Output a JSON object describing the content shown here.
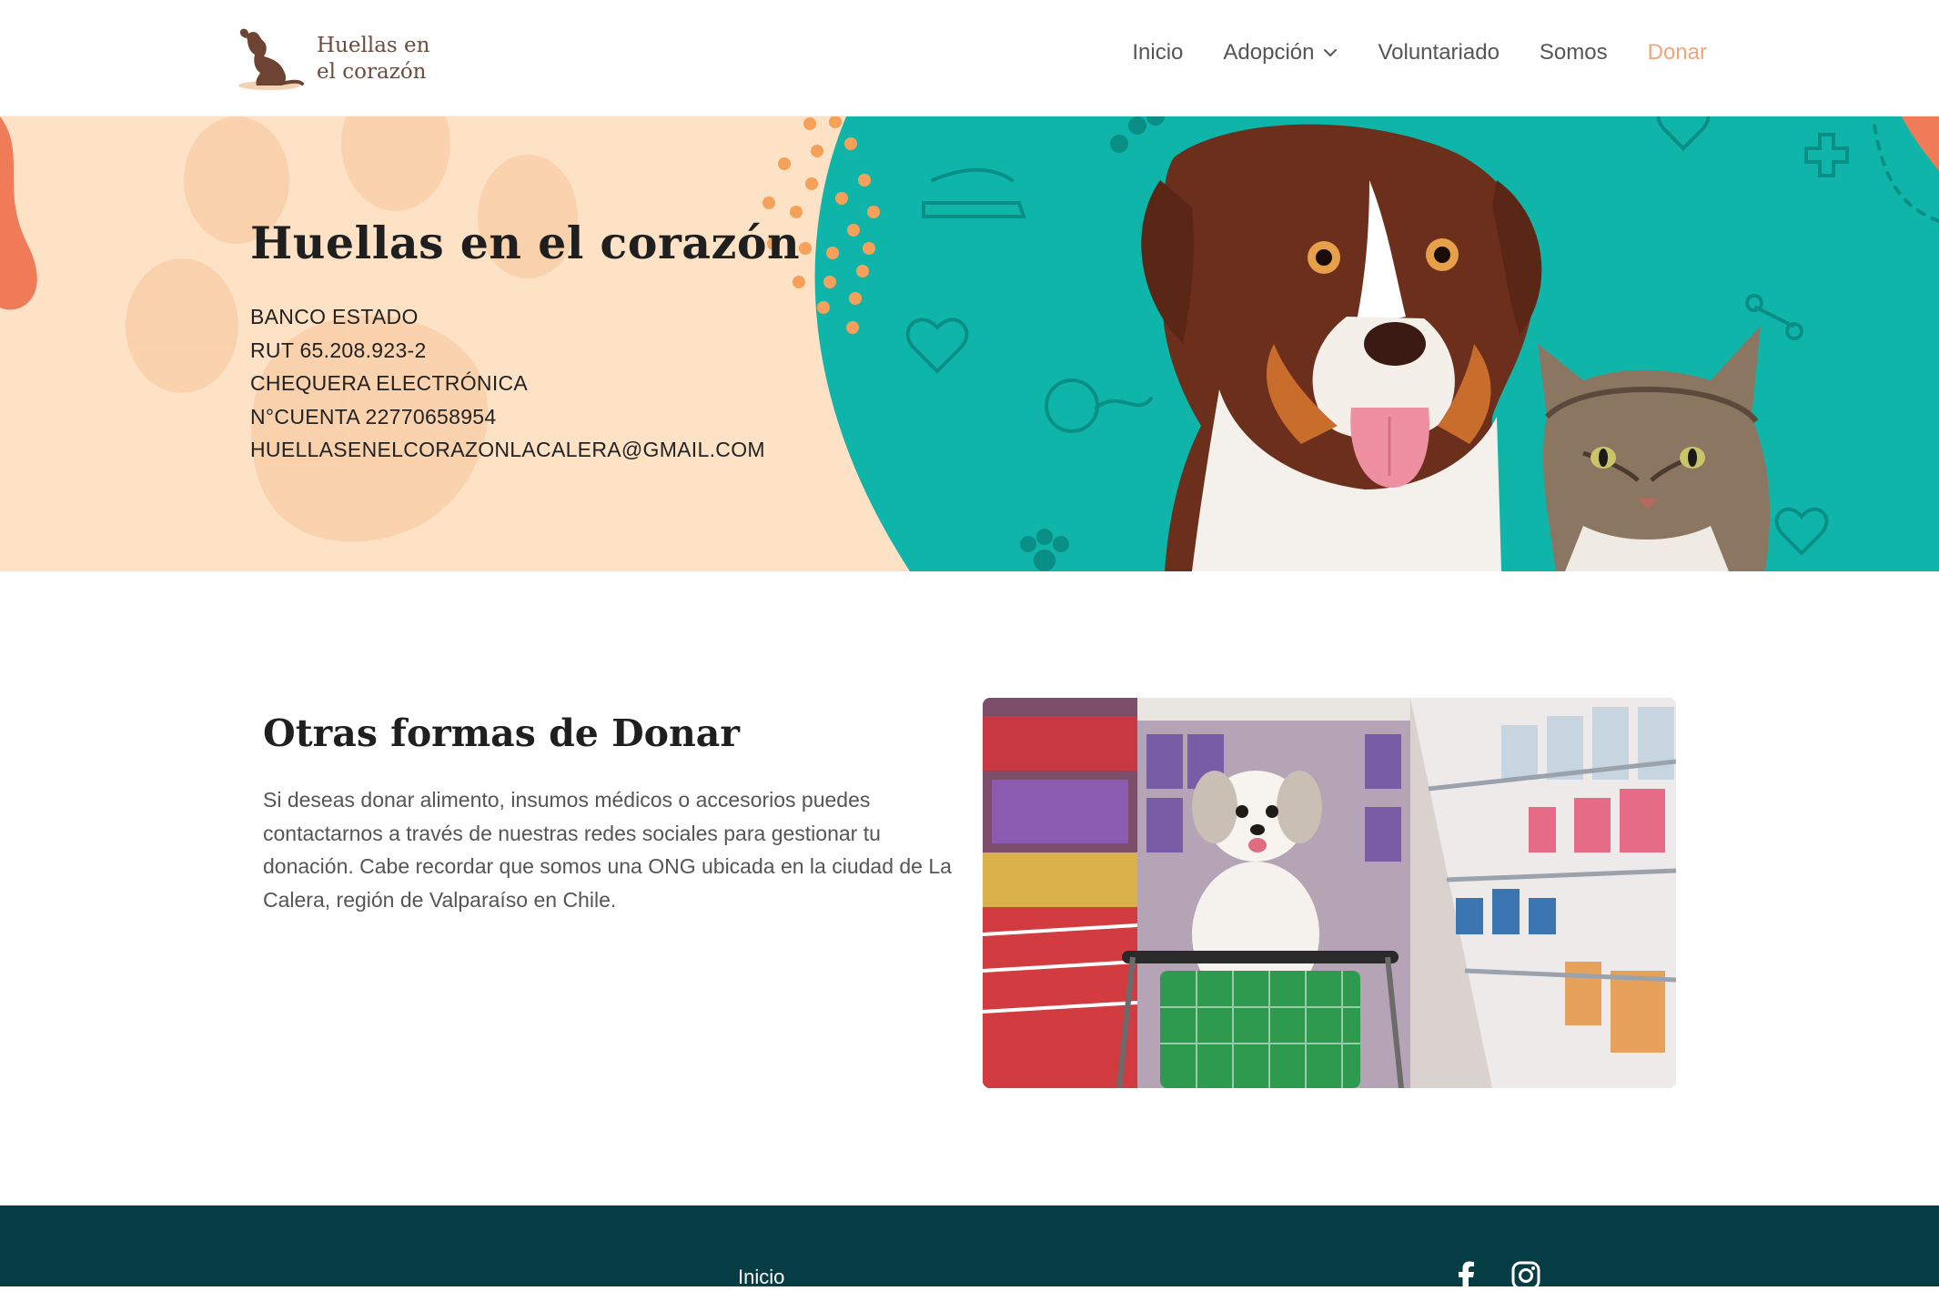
{
  "header": {
    "logo_text_line1": "Huellas en",
    "logo_text_line2": "el corazón",
    "nav": [
      {
        "label": "Inicio"
      },
      {
        "label": "Adopción"
      },
      {
        "label": "Voluntariado"
      },
      {
        "label": "Somos"
      },
      {
        "label": "Donar"
      }
    ],
    "active_color": "#f0a67c"
  },
  "hero": {
    "title": "Huellas en el corazón",
    "bank_lines": [
      "BANCO ESTADO",
      "RUT 65.208.923-2",
      "CHEQUERA ELECTRÓNICA",
      "N°CUENTA 22770658954",
      "HUELLASENELCORAZONLACALERA@GMAIL.COM"
    ],
    "colors": {
      "peach": "#fde2c6",
      "teal": "#10b5aa",
      "coral": "#f07b58",
      "orange_dots": "#f6a15a"
    }
  },
  "other": {
    "title": "Otras formas de Donar",
    "paragraph": "Si deseas donar alimento, insumos médicos o accesorios puedes contactarnos a través de nuestras redes sociales  para gestionar tu donación. Cabe recordar que somos una ONG ubicada en la ciudad de La Calera, región de Valparaíso en Chile."
  },
  "footer": {
    "link": "Inicio",
    "social": [
      "facebook-icon",
      "instagram-icon"
    ],
    "bg": "#063c44"
  }
}
